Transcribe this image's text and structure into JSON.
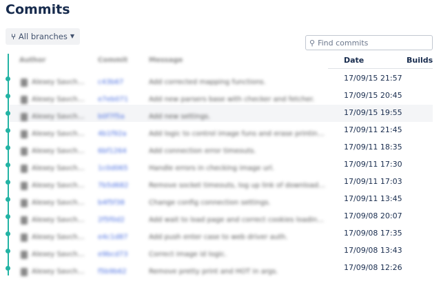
{
  "page": {
    "title": "Commits"
  },
  "toolbar": {
    "branch_label": "All branches",
    "search_placeholder": "Find commits"
  },
  "columns": {
    "author": "Author",
    "commit": "Commit",
    "message": "Message",
    "date": "Date",
    "builds": "Builds"
  },
  "accent": "#23b3a4",
  "commits": [
    {
      "author": "Alexey Savche...",
      "hash": "c43b67",
      "message": "Add corrected mapping functions.",
      "date": "17/09/15 21:57"
    },
    {
      "author": "Alexey Savche...",
      "hash": "e7eb071",
      "message": "Add new parsers base with checker and fetcher.",
      "date": "17/09/15 20:45"
    },
    {
      "author": "Alexey Savche...",
      "hash": "b0f7f5a",
      "message": "Add new settings.",
      "date": "17/09/15 19:55"
    },
    {
      "author": "Alexey Savche...",
      "hash": "4b1f92a",
      "message": "Add logic to control image funs and erase printing ou...",
      "date": "17/09/11 21:45"
    },
    {
      "author": "Alexey Savche...",
      "hash": "6bf1264",
      "message": "Add connection error timeouts.",
      "date": "17/09/11 18:35"
    },
    {
      "author": "Alexey Savche...",
      "hash": "1c0d065",
      "message": "Handle errors in checking image url.",
      "date": "17/09/11 17:30"
    },
    {
      "author": "Alexey Savche...",
      "hash": "7b5d682",
      "message": "Remove socket timeouts, log up link of downloaded i...",
      "date": "17/09/11 17:03"
    },
    {
      "author": "Alexey Savche...",
      "hash": "b4f5f38",
      "message": "Change config connection settings.",
      "date": "17/09/11 13:45"
    },
    {
      "author": "Alexey Savche...",
      "hash": "2f5f0d2",
      "message": "Add wait to load page and correct cookies loading fro...",
      "date": "17/09/08 20:07"
    },
    {
      "author": "Alexey Savche...",
      "hash": "e4c1d87",
      "message": "Add push enter case to web driver auth.",
      "date": "17/09/08 17:35"
    },
    {
      "author": "Alexey Savche...",
      "hash": "e9bcd73",
      "message": "Correct image id logic.",
      "date": "17/09/08 13:43"
    },
    {
      "author": "Alexey Savche...",
      "hash": "f5b9b62",
      "message": "Remove pretty print and HOT in args.",
      "date": "17/09/08 12:26"
    }
  ]
}
